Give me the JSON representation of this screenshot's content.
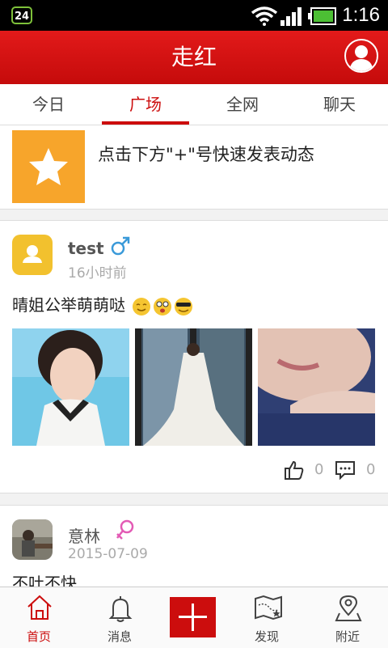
{
  "status_bar": {
    "badge": "24",
    "time": "1:16"
  },
  "app": {
    "title": "走红"
  },
  "tabs": [
    {
      "label": "今日",
      "active": false
    },
    {
      "label": "广场",
      "active": true
    },
    {
      "label": "全网",
      "active": false
    },
    {
      "label": "聊天",
      "active": false
    }
  ],
  "banner": {
    "text": "点击下方\"+\"号快速发表动态"
  },
  "posts": [
    {
      "username": "test",
      "gender": "male",
      "time": "16小时前",
      "text": "晴姐公举萌萌哒",
      "likes": "0",
      "comments": "0"
    },
    {
      "username": "意林",
      "gender": "female",
      "time": "2015-07-09",
      "text": "不吐不快"
    }
  ],
  "bottom_nav": [
    {
      "label": "首页",
      "icon": "home-icon",
      "active": true
    },
    {
      "label": "消息",
      "icon": "bell-icon",
      "active": false
    },
    {
      "label": "",
      "icon": "plus-icon",
      "active": false
    },
    {
      "label": "发现",
      "icon": "map-icon",
      "active": false
    },
    {
      "label": "附近",
      "icon": "location-pin-icon",
      "active": false
    }
  ],
  "colors": {
    "brand_red": "#cc0d0d",
    "star_orange": "#f7a52b",
    "male_blue": "#3a9ad9",
    "female_pink": "#e35bb5"
  }
}
